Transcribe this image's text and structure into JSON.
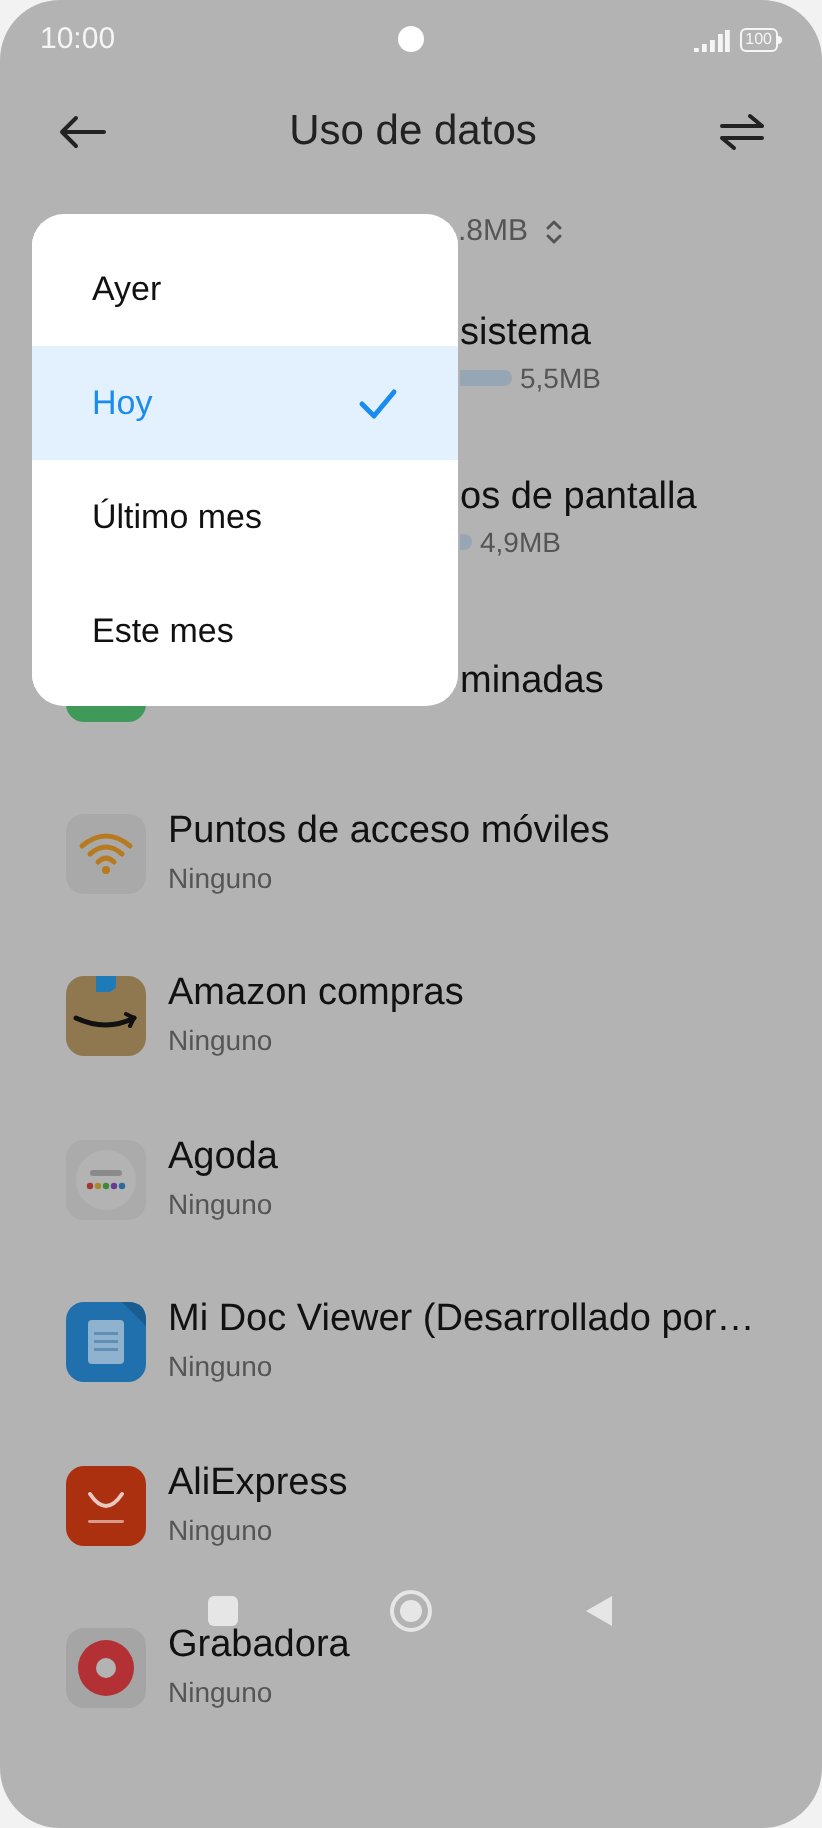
{
  "status_bar": {
    "time": "10:00",
    "battery": "100"
  },
  "header": {
    "title": "Uso de datos"
  },
  "total": {
    "value": ".8MB"
  },
  "background_rows": [
    {
      "title": "sistema",
      "usage": "5,5MB",
      "kind": "bar"
    },
    {
      "title": "os de pantalla",
      "usage": "4,9MB",
      "kind": "bar"
    },
    {
      "title": "minadas",
      "kind": "icon"
    }
  ],
  "menu": [
    {
      "label": "Ayer",
      "selected": false
    },
    {
      "label": "Hoy",
      "selected": true
    },
    {
      "label": "Último mes",
      "selected": false
    },
    {
      "label": "Este mes",
      "selected": false
    }
  ],
  "apps": [
    {
      "name": "Puntos de acceso móviles",
      "usage": "Ninguno",
      "kind": "hotspot"
    },
    {
      "name": "Amazon compras",
      "usage": "Ninguno",
      "kind": "amazon"
    },
    {
      "name": "Agoda",
      "usage": "Ninguno",
      "kind": "agoda"
    },
    {
      "name": "Mi Doc Viewer (Desarrollado por…",
      "usage": "Ninguno",
      "kind": "doc"
    },
    {
      "name": "AliExpress",
      "usage": "Ninguno",
      "kind": "aliexpress"
    },
    {
      "name": "Grabadora",
      "usage": "Ninguno",
      "kind": "recorder"
    }
  ]
}
